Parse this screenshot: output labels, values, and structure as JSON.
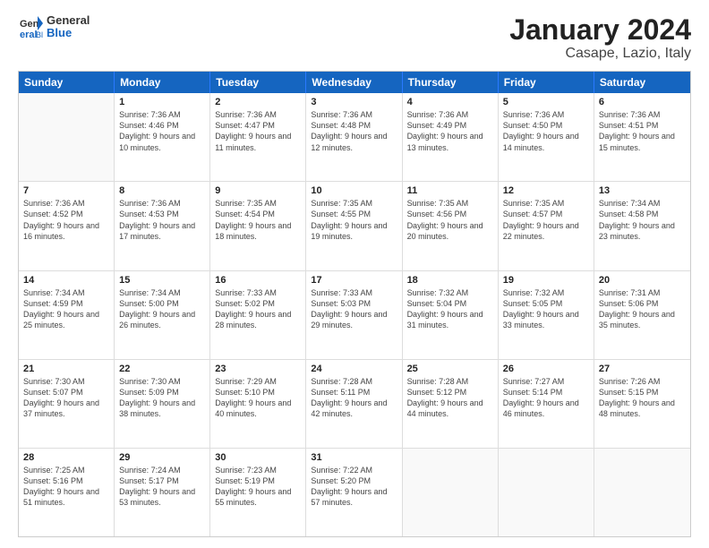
{
  "logo": {
    "general": "General",
    "blue": "Blue"
  },
  "title": "January 2024",
  "subtitle": "Casape, Lazio, Italy",
  "days": [
    "Sunday",
    "Monday",
    "Tuesday",
    "Wednesday",
    "Thursday",
    "Friday",
    "Saturday"
  ],
  "weeks": [
    [
      {
        "date": "",
        "sunrise": "",
        "sunset": "",
        "daylight": ""
      },
      {
        "date": "1",
        "sunrise": "Sunrise: 7:36 AM",
        "sunset": "Sunset: 4:46 PM",
        "daylight": "Daylight: 9 hours and 10 minutes."
      },
      {
        "date": "2",
        "sunrise": "Sunrise: 7:36 AM",
        "sunset": "Sunset: 4:47 PM",
        "daylight": "Daylight: 9 hours and 11 minutes."
      },
      {
        "date": "3",
        "sunrise": "Sunrise: 7:36 AM",
        "sunset": "Sunset: 4:48 PM",
        "daylight": "Daylight: 9 hours and 12 minutes."
      },
      {
        "date": "4",
        "sunrise": "Sunrise: 7:36 AM",
        "sunset": "Sunset: 4:49 PM",
        "daylight": "Daylight: 9 hours and 13 minutes."
      },
      {
        "date": "5",
        "sunrise": "Sunrise: 7:36 AM",
        "sunset": "Sunset: 4:50 PM",
        "daylight": "Daylight: 9 hours and 14 minutes."
      },
      {
        "date": "6",
        "sunrise": "Sunrise: 7:36 AM",
        "sunset": "Sunset: 4:51 PM",
        "daylight": "Daylight: 9 hours and 15 minutes."
      }
    ],
    [
      {
        "date": "7",
        "sunrise": "Sunrise: 7:36 AM",
        "sunset": "Sunset: 4:52 PM",
        "daylight": "Daylight: 9 hours and 16 minutes."
      },
      {
        "date": "8",
        "sunrise": "Sunrise: 7:36 AM",
        "sunset": "Sunset: 4:53 PM",
        "daylight": "Daylight: 9 hours and 17 minutes."
      },
      {
        "date": "9",
        "sunrise": "Sunrise: 7:35 AM",
        "sunset": "Sunset: 4:54 PM",
        "daylight": "Daylight: 9 hours and 18 minutes."
      },
      {
        "date": "10",
        "sunrise": "Sunrise: 7:35 AM",
        "sunset": "Sunset: 4:55 PM",
        "daylight": "Daylight: 9 hours and 19 minutes."
      },
      {
        "date": "11",
        "sunrise": "Sunrise: 7:35 AM",
        "sunset": "Sunset: 4:56 PM",
        "daylight": "Daylight: 9 hours and 20 minutes."
      },
      {
        "date": "12",
        "sunrise": "Sunrise: 7:35 AM",
        "sunset": "Sunset: 4:57 PM",
        "daylight": "Daylight: 9 hours and 22 minutes."
      },
      {
        "date": "13",
        "sunrise": "Sunrise: 7:34 AM",
        "sunset": "Sunset: 4:58 PM",
        "daylight": "Daylight: 9 hours and 23 minutes."
      }
    ],
    [
      {
        "date": "14",
        "sunrise": "Sunrise: 7:34 AM",
        "sunset": "Sunset: 4:59 PM",
        "daylight": "Daylight: 9 hours and 25 minutes."
      },
      {
        "date": "15",
        "sunrise": "Sunrise: 7:34 AM",
        "sunset": "Sunset: 5:00 PM",
        "daylight": "Daylight: 9 hours and 26 minutes."
      },
      {
        "date": "16",
        "sunrise": "Sunrise: 7:33 AM",
        "sunset": "Sunset: 5:02 PM",
        "daylight": "Daylight: 9 hours and 28 minutes."
      },
      {
        "date": "17",
        "sunrise": "Sunrise: 7:33 AM",
        "sunset": "Sunset: 5:03 PM",
        "daylight": "Daylight: 9 hours and 29 minutes."
      },
      {
        "date": "18",
        "sunrise": "Sunrise: 7:32 AM",
        "sunset": "Sunset: 5:04 PM",
        "daylight": "Daylight: 9 hours and 31 minutes."
      },
      {
        "date": "19",
        "sunrise": "Sunrise: 7:32 AM",
        "sunset": "Sunset: 5:05 PM",
        "daylight": "Daylight: 9 hours and 33 minutes."
      },
      {
        "date": "20",
        "sunrise": "Sunrise: 7:31 AM",
        "sunset": "Sunset: 5:06 PM",
        "daylight": "Daylight: 9 hours and 35 minutes."
      }
    ],
    [
      {
        "date": "21",
        "sunrise": "Sunrise: 7:30 AM",
        "sunset": "Sunset: 5:07 PM",
        "daylight": "Daylight: 9 hours and 37 minutes."
      },
      {
        "date": "22",
        "sunrise": "Sunrise: 7:30 AM",
        "sunset": "Sunset: 5:09 PM",
        "daylight": "Daylight: 9 hours and 38 minutes."
      },
      {
        "date": "23",
        "sunrise": "Sunrise: 7:29 AM",
        "sunset": "Sunset: 5:10 PM",
        "daylight": "Daylight: 9 hours and 40 minutes."
      },
      {
        "date": "24",
        "sunrise": "Sunrise: 7:28 AM",
        "sunset": "Sunset: 5:11 PM",
        "daylight": "Daylight: 9 hours and 42 minutes."
      },
      {
        "date": "25",
        "sunrise": "Sunrise: 7:28 AM",
        "sunset": "Sunset: 5:12 PM",
        "daylight": "Daylight: 9 hours and 44 minutes."
      },
      {
        "date": "26",
        "sunrise": "Sunrise: 7:27 AM",
        "sunset": "Sunset: 5:14 PM",
        "daylight": "Daylight: 9 hours and 46 minutes."
      },
      {
        "date": "27",
        "sunrise": "Sunrise: 7:26 AM",
        "sunset": "Sunset: 5:15 PM",
        "daylight": "Daylight: 9 hours and 48 minutes."
      }
    ],
    [
      {
        "date": "28",
        "sunrise": "Sunrise: 7:25 AM",
        "sunset": "Sunset: 5:16 PM",
        "daylight": "Daylight: 9 hours and 51 minutes."
      },
      {
        "date": "29",
        "sunrise": "Sunrise: 7:24 AM",
        "sunset": "Sunset: 5:17 PM",
        "daylight": "Daylight: 9 hours and 53 minutes."
      },
      {
        "date": "30",
        "sunrise": "Sunrise: 7:23 AM",
        "sunset": "Sunset: 5:19 PM",
        "daylight": "Daylight: 9 hours and 55 minutes."
      },
      {
        "date": "31",
        "sunrise": "Sunrise: 7:22 AM",
        "sunset": "Sunset: 5:20 PM",
        "daylight": "Daylight: 9 hours and 57 minutes."
      },
      {
        "date": "",
        "sunrise": "",
        "sunset": "",
        "daylight": ""
      },
      {
        "date": "",
        "sunrise": "",
        "sunset": "",
        "daylight": ""
      },
      {
        "date": "",
        "sunrise": "",
        "sunset": "",
        "daylight": ""
      }
    ]
  ]
}
